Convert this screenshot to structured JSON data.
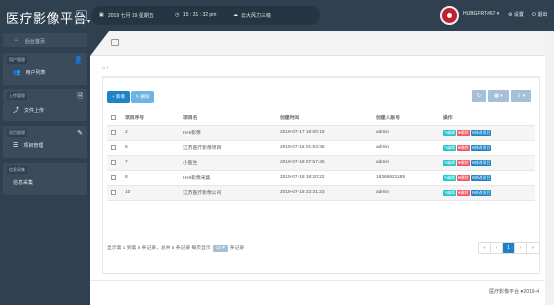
{
  "header": {
    "brand": "医疗影像平台",
    "brand_caret": "▾",
    "menu_toggle": "≡",
    "date": "2019 七月 19 星期五",
    "time": "15 : 31 : 32 pm",
    "weather": "云大风力三级",
    "username": "HUBGFRT#67 ▾",
    "settings": "设置",
    "exit": "退出"
  },
  "sidebar": {
    "home": "后台首页",
    "groups": [
      {
        "tag": "用户管理",
        "item": "用户列表",
        "icon": "users-icon"
      },
      {
        "tag": "上传管理",
        "item": "文件上传",
        "icon": "upload-icon"
      },
      {
        "tag": "项目管理",
        "item": "项目管理",
        "icon": "list-icon"
      },
      {
        "tag": "信息采集",
        "item": "信息采集",
        "icon": "collect-icon"
      }
    ]
  },
  "breadcrumb": "⌂  ›",
  "toolbar": {
    "add": "+ 新增",
    "delete": "✎ 删除",
    "refresh": "↻",
    "columns": "▦ ▾",
    "export": "⇩ ▾"
  },
  "table": {
    "columns": [
      "",
      "项目序号",
      "项目名",
      "创建时间",
      "创建人账号",
      "操作"
    ],
    "rows": [
      {
        "id": "2",
        "name": "HHI影像",
        "time": "2019-07-17 18:00:18",
        "creator": "admin"
      },
      {
        "id": "6",
        "name": "江苏医疗影像项目",
        "time": "2019-07-18 01:53:35",
        "creator": "admin"
      },
      {
        "id": "7",
        "name": "小医生",
        "time": "2019-07-18 07:57:46",
        "creator": "admin"
      },
      {
        "id": "8",
        "name": "HHI影像采集",
        "time": "2019-07-18 18:20:22",
        "creator": "18368621189"
      },
      {
        "id": "10",
        "name": "江苏医疗影像公司",
        "time": "2019-07-18 23:31:23",
        "creator": "admin"
      }
    ],
    "actions": {
      "edit": "✎编辑",
      "delete": "✖删除",
      "config": "⚙修改项目"
    }
  },
  "pagination": {
    "info_prefix": "显示第 1 到第 5 条记录，总共 5 条记录 每页显示",
    "page_size": "10 ▾",
    "info_suffix": "条记录",
    "buttons": [
      "«",
      "‹",
      "1",
      "›",
      "»"
    ],
    "active_index": 2
  },
  "footer": "医疗影像平台 ♥2019-4"
}
